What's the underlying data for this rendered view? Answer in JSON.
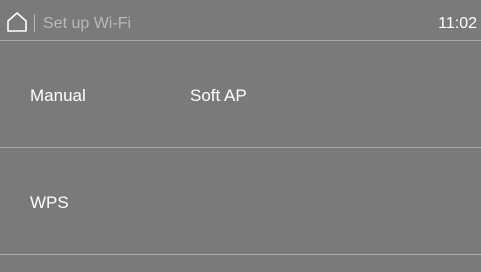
{
  "header": {
    "home_icon": "home-icon",
    "title": "Set up Wi-Fi",
    "time": "11:02"
  },
  "options": {
    "manual": "Manual",
    "soft_ap": "Soft AP",
    "wps": "WPS"
  },
  "colors": {
    "background": "#7a7a7c",
    "text": "#ffffff",
    "title_text": "#b9b9bb",
    "divider": "#a8a8aa"
  }
}
